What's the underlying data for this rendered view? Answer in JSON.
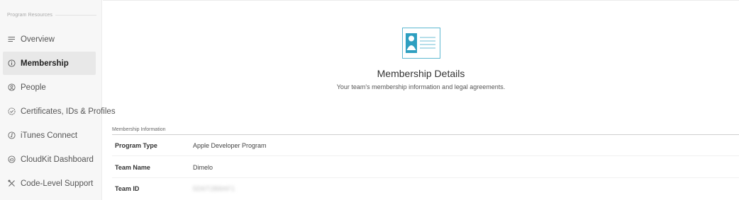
{
  "sidebar": {
    "section_title": "Program Resources",
    "items": [
      {
        "label": "Overview",
        "icon": "list-icon"
      },
      {
        "label": "Membership",
        "icon": "info-icon"
      },
      {
        "label": "People",
        "icon": "person-icon"
      },
      {
        "label": "Certificates, IDs & Profiles",
        "icon": "gear-check-icon"
      },
      {
        "label": "iTunes Connect",
        "icon": "itunes-icon"
      },
      {
        "label": "CloudKit Dashboard",
        "icon": "cloud-icon"
      },
      {
        "label": "Code-Level Support",
        "icon": "tools-icon"
      }
    ],
    "active_item": "Membership"
  },
  "main": {
    "title": "Membership Details",
    "subtitle": "Your team's membership information and legal agreements.",
    "section_title": "Membership Information",
    "rows": [
      {
        "label": "Program Type",
        "value": "Apple Developer Program"
      },
      {
        "label": "Team Name",
        "value": "Dimelo"
      },
      {
        "label": "Team ID",
        "value": "5D6T2B8AF1"
      }
    ]
  },
  "colors": {
    "accent": "#5eb8d1",
    "sidebar_bg": "#f7f7f7",
    "active_bg": "#e8e8e8"
  }
}
